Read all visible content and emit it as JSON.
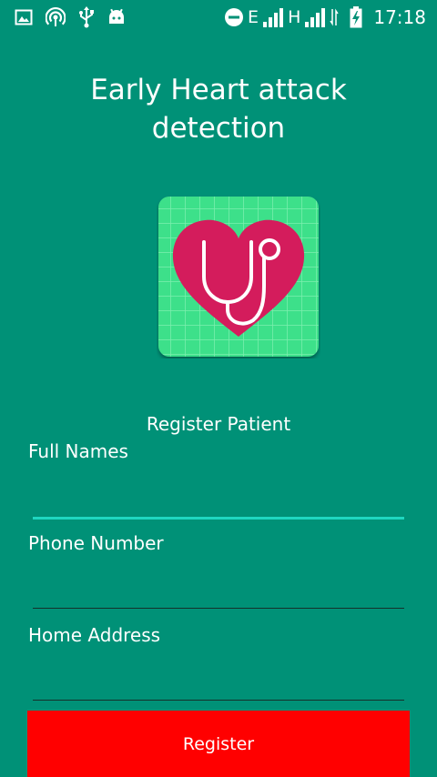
{
  "status_bar": {
    "network_type_1": "E",
    "network_type_2": "H",
    "time": "17:18",
    "icons": [
      "image-icon",
      "hotspot-icon",
      "usb-icon",
      "android-debug-icon",
      "do-not-disturb-icon",
      "signal-icon",
      "signal-icon",
      "sync-icon",
      "battery-charging-icon"
    ]
  },
  "header": {
    "title": "Early Heart attack detection"
  },
  "logo": {
    "icon": "heart-stethoscope-icon",
    "colors": {
      "tile": "#3ee08a",
      "heart": "#d41c5c"
    }
  },
  "form": {
    "section_label": "Register Patient",
    "fields": [
      {
        "label": "Full Names",
        "value": "",
        "focused": true
      },
      {
        "label": "Phone Number",
        "value": ""
      },
      {
        "label": "Home Address",
        "value": ""
      }
    ],
    "submit_label": "Register"
  },
  "colors": {
    "background": "#009177",
    "accent": "#1fd6c0",
    "button": "#ff0000"
  }
}
